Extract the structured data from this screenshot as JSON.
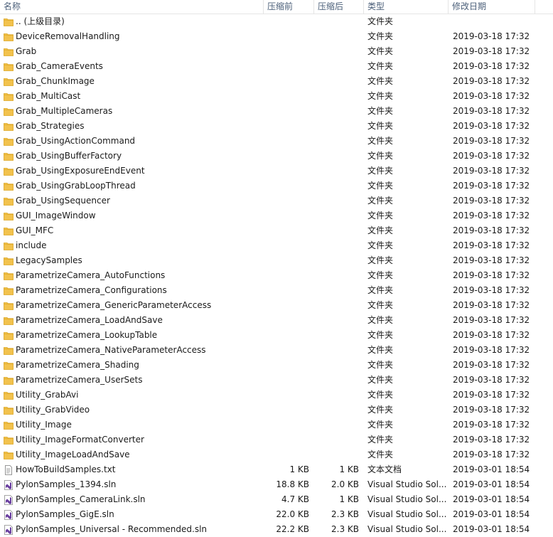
{
  "columns": {
    "name": "名称",
    "compressed": "压缩前",
    "actual": "压缩后",
    "type": "类型",
    "modified": "修改日期"
  },
  "colors": {
    "header_text": "#4c607a",
    "folder": "#f2c24d",
    "folder_dark": "#dba520",
    "vs_purple": "#6a3fa0"
  },
  "rows": [
    {
      "name": ".. (上级目录)",
      "csize": "",
      "asize": "",
      "type": "文件夹",
      "date": "",
      "icon": "folder-icon"
    },
    {
      "name": "DeviceRemovalHandling",
      "csize": "",
      "asize": "",
      "type": "文件夹",
      "date": "2019-03-18 17:32",
      "icon": "folder-icon"
    },
    {
      "name": "Grab",
      "csize": "",
      "asize": "",
      "type": "文件夹",
      "date": "2019-03-18 17:32",
      "icon": "folder-icon"
    },
    {
      "name": "Grab_CameraEvents",
      "csize": "",
      "asize": "",
      "type": "文件夹",
      "date": "2019-03-18 17:32",
      "icon": "folder-icon"
    },
    {
      "name": "Grab_ChunkImage",
      "csize": "",
      "asize": "",
      "type": "文件夹",
      "date": "2019-03-18 17:32",
      "icon": "folder-icon"
    },
    {
      "name": "Grab_MultiCast",
      "csize": "",
      "asize": "",
      "type": "文件夹",
      "date": "2019-03-18 17:32",
      "icon": "folder-icon"
    },
    {
      "name": "Grab_MultipleCameras",
      "csize": "",
      "asize": "",
      "type": "文件夹",
      "date": "2019-03-18 17:32",
      "icon": "folder-icon"
    },
    {
      "name": "Grab_Strategies",
      "csize": "",
      "asize": "",
      "type": "文件夹",
      "date": "2019-03-18 17:32",
      "icon": "folder-icon"
    },
    {
      "name": "Grab_UsingActionCommand",
      "csize": "",
      "asize": "",
      "type": "文件夹",
      "date": "2019-03-18 17:32",
      "icon": "folder-icon"
    },
    {
      "name": "Grab_UsingBufferFactory",
      "csize": "",
      "asize": "",
      "type": "文件夹",
      "date": "2019-03-18 17:32",
      "icon": "folder-icon"
    },
    {
      "name": "Grab_UsingExposureEndEvent",
      "csize": "",
      "asize": "",
      "type": "文件夹",
      "date": "2019-03-18 17:32",
      "icon": "folder-icon"
    },
    {
      "name": "Grab_UsingGrabLoopThread",
      "csize": "",
      "asize": "",
      "type": "文件夹",
      "date": "2019-03-18 17:32",
      "icon": "folder-icon"
    },
    {
      "name": "Grab_UsingSequencer",
      "csize": "",
      "asize": "",
      "type": "文件夹",
      "date": "2019-03-18 17:32",
      "icon": "folder-icon"
    },
    {
      "name": "GUI_ImageWindow",
      "csize": "",
      "asize": "",
      "type": "文件夹",
      "date": "2019-03-18 17:32",
      "icon": "folder-icon"
    },
    {
      "name": "GUI_MFC",
      "csize": "",
      "asize": "",
      "type": "文件夹",
      "date": "2019-03-18 17:32",
      "icon": "folder-icon"
    },
    {
      "name": "include",
      "csize": "",
      "asize": "",
      "type": "文件夹",
      "date": "2019-03-18 17:32",
      "icon": "folder-icon"
    },
    {
      "name": "LegacySamples",
      "csize": "",
      "asize": "",
      "type": "文件夹",
      "date": "2019-03-18 17:32",
      "icon": "folder-icon"
    },
    {
      "name": "ParametrizeCamera_AutoFunctions",
      "csize": "",
      "asize": "",
      "type": "文件夹",
      "date": "2019-03-18 17:32",
      "icon": "folder-icon"
    },
    {
      "name": "ParametrizeCamera_Configurations",
      "csize": "",
      "asize": "",
      "type": "文件夹",
      "date": "2019-03-18 17:32",
      "icon": "folder-icon"
    },
    {
      "name": "ParametrizeCamera_GenericParameterAccess",
      "csize": "",
      "asize": "",
      "type": "文件夹",
      "date": "2019-03-18 17:32",
      "icon": "folder-icon"
    },
    {
      "name": "ParametrizeCamera_LoadAndSave",
      "csize": "",
      "asize": "",
      "type": "文件夹",
      "date": "2019-03-18 17:32",
      "icon": "folder-icon"
    },
    {
      "name": "ParametrizeCamera_LookupTable",
      "csize": "",
      "asize": "",
      "type": "文件夹",
      "date": "2019-03-18 17:32",
      "icon": "folder-icon"
    },
    {
      "name": "ParametrizeCamera_NativeParameterAccess",
      "csize": "",
      "asize": "",
      "type": "文件夹",
      "date": "2019-03-18 17:32",
      "icon": "folder-icon"
    },
    {
      "name": "ParametrizeCamera_Shading",
      "csize": "",
      "asize": "",
      "type": "文件夹",
      "date": "2019-03-18 17:32",
      "icon": "folder-icon"
    },
    {
      "name": "ParametrizeCamera_UserSets",
      "csize": "",
      "asize": "",
      "type": "文件夹",
      "date": "2019-03-18 17:32",
      "icon": "folder-icon"
    },
    {
      "name": "Utility_GrabAvi",
      "csize": "",
      "asize": "",
      "type": "文件夹",
      "date": "2019-03-18 17:32",
      "icon": "folder-icon"
    },
    {
      "name": "Utility_GrabVideo",
      "csize": "",
      "asize": "",
      "type": "文件夹",
      "date": "2019-03-18 17:32",
      "icon": "folder-icon"
    },
    {
      "name": "Utility_Image",
      "csize": "",
      "asize": "",
      "type": "文件夹",
      "date": "2019-03-18 17:32",
      "icon": "folder-icon"
    },
    {
      "name": "Utility_ImageFormatConverter",
      "csize": "",
      "asize": "",
      "type": "文件夹",
      "date": "2019-03-18 17:32",
      "icon": "folder-icon"
    },
    {
      "name": "Utility_ImageLoadAndSave",
      "csize": "",
      "asize": "",
      "type": "文件夹",
      "date": "2019-03-18 17:32",
      "icon": "folder-icon"
    },
    {
      "name": "HowToBuildSamples.txt",
      "csize": "1 KB",
      "asize": "1 KB",
      "type": "文本文档",
      "date": "2019-03-01 18:54",
      "icon": "text-file-icon"
    },
    {
      "name": "PylonSamples_1394.sln",
      "csize": "18.8 KB",
      "asize": "2.0 KB",
      "type": "Visual Studio Sol...",
      "date": "2019-03-01 18:54",
      "icon": "visual-studio-solution-icon"
    },
    {
      "name": "PylonSamples_CameraLink.sln",
      "csize": "4.7 KB",
      "asize": "1 KB",
      "type": "Visual Studio Sol...",
      "date": "2019-03-01 18:54",
      "icon": "visual-studio-solution-icon"
    },
    {
      "name": "PylonSamples_GigE.sln",
      "csize": "22.0 KB",
      "asize": "2.3 KB",
      "type": "Visual Studio Sol...",
      "date": "2019-03-01 18:54",
      "icon": "visual-studio-solution-icon"
    },
    {
      "name": "PylonSamples_Universal - Recommended.sln",
      "csize": "22.2 KB",
      "asize": "2.3 KB",
      "type": "Visual Studio Sol...",
      "date": "2019-03-01 18:54",
      "icon": "visual-studio-solution-icon"
    }
  ]
}
